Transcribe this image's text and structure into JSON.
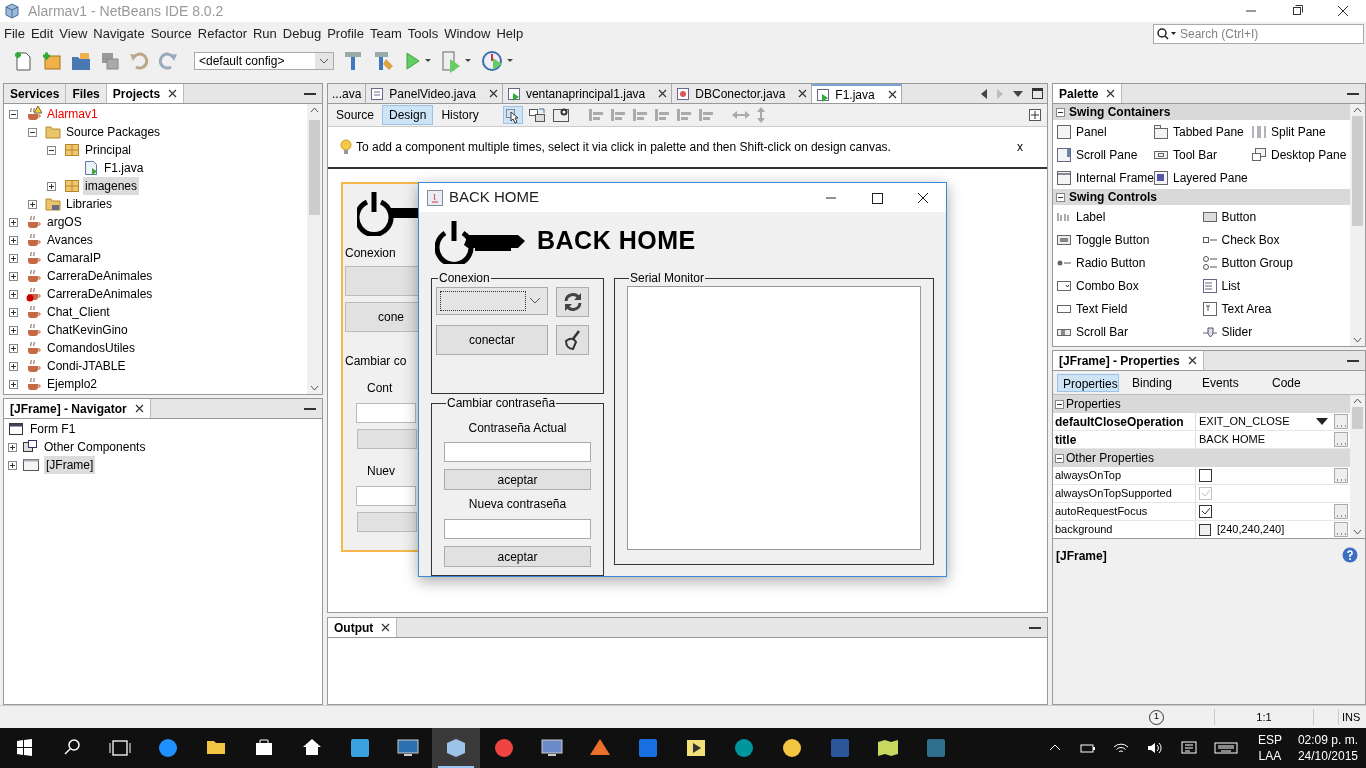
{
  "window": {
    "title": "Alarmav1 - NetBeans IDE 8.0.2"
  },
  "menu": [
    "File",
    "Edit",
    "View",
    "Navigate",
    "Source",
    "Refactor",
    "Run",
    "Debug",
    "Profile",
    "Team",
    "Tools",
    "Window",
    "Help"
  ],
  "search": {
    "placeholder": "Search (Ctrl+I)"
  },
  "toolbar": {
    "config": "<default config>"
  },
  "projects_panel": {
    "tabs": [
      {
        "label": "Services",
        "selected": false,
        "closable": false
      },
      {
        "label": "Files",
        "selected": false,
        "closable": false
      },
      {
        "label": "Projects",
        "selected": true,
        "closable": true
      }
    ],
    "tree": [
      {
        "label": "Alarmav1",
        "kind": "project",
        "warning": true,
        "broken": false,
        "expanded": true,
        "selected": false,
        "children": [
          {
            "label": "Source Packages",
            "kind": "sources",
            "expanded": true,
            "selected": false,
            "children": [
              {
                "label": "Principal",
                "kind": "package",
                "expanded": true,
                "selected": false,
                "children": [
                  {
                    "label": "F1.java",
                    "kind": "file",
                    "selected": false
                  }
                ]
              },
              {
                "label": "imagenes",
                "kind": "package",
                "expanded": false,
                "selected": true
              }
            ]
          },
          {
            "label": "Libraries",
            "kind": "libraries",
            "expanded": false,
            "selected": false
          }
        ]
      },
      {
        "label": "argOS",
        "kind": "project",
        "warning": false,
        "broken": false,
        "expanded": false,
        "selected": false
      },
      {
        "label": "Avances",
        "kind": "project",
        "warning": false,
        "broken": false,
        "expanded": false,
        "selected": false
      },
      {
        "label": "CamaraIP",
        "kind": "project",
        "warning": false,
        "broken": false,
        "expanded": false,
        "selected": false
      },
      {
        "label": "CarreraDeAnimales",
        "kind": "project",
        "warning": false,
        "broken": false,
        "expanded": false,
        "selected": false
      },
      {
        "label": "CarreraDeAnimales",
        "kind": "project",
        "warning": false,
        "broken": true,
        "expanded": false,
        "selected": false
      },
      {
        "label": "Chat_Client",
        "kind": "project",
        "warning": false,
        "broken": false,
        "expanded": false,
        "selected": false
      },
      {
        "label": "ChatKevinGino",
        "kind": "project",
        "warning": false,
        "broken": false,
        "expanded": false,
        "selected": false
      },
      {
        "label": "ComandosUtiles",
        "kind": "project",
        "warning": false,
        "broken": false,
        "expanded": false,
        "selected": false
      },
      {
        "label": "Condi-JTABLE",
        "kind": "project",
        "warning": false,
        "broken": false,
        "expanded": false,
        "selected": false
      },
      {
        "label": "Ejemplo2",
        "kind": "project",
        "warning": false,
        "broken": false,
        "expanded": false,
        "selected": false
      }
    ]
  },
  "navigator": {
    "title": "[JFrame] - Navigator",
    "tree": [
      {
        "label": "Form F1",
        "kind": "form",
        "selected": false
      },
      {
        "label": "Other Components",
        "kind": "components",
        "expanded": false,
        "selected": false
      },
      {
        "label": "[JFrame]",
        "kind": "frame",
        "expanded": false,
        "selected": true
      }
    ]
  },
  "editor": {
    "tabs": [
      {
        "label": "...ava",
        "kind": "none",
        "selected": false,
        "closable": false
      },
      {
        "label": "PanelVideo.java",
        "kind": "class",
        "selected": false,
        "closable": true
      },
      {
        "label": "ventanaprincipal1.java",
        "kind": "form",
        "selected": false,
        "closable": true
      },
      {
        "label": "DBConector.java",
        "kind": "db",
        "selected": false,
        "closable": true
      },
      {
        "label": "F1.java",
        "kind": "form",
        "selected": true,
        "closable": true
      }
    ],
    "views": [
      {
        "label": "Source",
        "selected": false
      },
      {
        "label": "Design",
        "selected": true
      },
      {
        "label": "History",
        "selected": false
      }
    ],
    "hint": {
      "text": "To add a component multiple times, select it via click in palette and then Shift-click on design canvas.",
      "close": "x"
    },
    "back_form": {
      "group1": "Conexion",
      "button": "cone",
      "group2": "Cambiar co",
      "label1": "Cont",
      "label2": "Nuev"
    },
    "form": {
      "title": "BACK HOME",
      "heading": "BACK HOME",
      "conexion": {
        "legend": "Conexion",
        "connect": "conectar"
      },
      "password": {
        "legend": "Cambiar contraseña",
        "current_label": "Contraseña Actual",
        "accept1": "aceptar",
        "new_label": "Nueva contraseña",
        "accept2": "aceptar"
      },
      "monitor": {
        "legend": "Serial Monitor"
      }
    }
  },
  "output": {
    "title": "Output"
  },
  "palette": {
    "title": "Palette",
    "categories": [
      {
        "label": "Swing Containers",
        "expanded": true,
        "items": [
          {
            "label": "Panel",
            "kind": "panel"
          },
          {
            "label": "Tabbed Pane",
            "kind": "tabs"
          },
          {
            "label": "Split Pane",
            "kind": "split"
          },
          {
            "label": "Scroll Pane",
            "kind": "scroll"
          },
          {
            "label": "Tool Bar",
            "kind": "toolbar"
          },
          {
            "label": "Desktop Pane",
            "kind": "desktop"
          },
          {
            "label": "Internal Frame",
            "kind": "frame"
          },
          {
            "label": "Layered Pane",
            "kind": "layered"
          }
        ]
      },
      {
        "label": "Swing Controls",
        "expanded": true,
        "items": [
          {
            "label": "Label",
            "kind": "label"
          },
          {
            "label": "Button",
            "kind": "button"
          },
          {
            "label": "Toggle Button",
            "kind": "toggle"
          },
          {
            "label": "Check Box",
            "kind": "check"
          },
          {
            "label": "Radio Button",
            "kind": "radio"
          },
          {
            "label": "Button Group",
            "kind": "group"
          },
          {
            "label": "Combo Box",
            "kind": "combo"
          },
          {
            "label": "List",
            "kind": "list"
          },
          {
            "label": "Text Field",
            "kind": "field"
          },
          {
            "label": "Text Area",
            "kind": "area"
          },
          {
            "label": "Scroll Bar",
            "kind": "scrollbar"
          },
          {
            "label": "Slider",
            "kind": "slider"
          }
        ]
      }
    ]
  },
  "properties": {
    "title": "[JFrame] - Properties",
    "tabs": [
      {
        "label": "Properties",
        "selected": true
      },
      {
        "label": "Binding",
        "selected": false
      },
      {
        "label": "Events",
        "selected": false
      },
      {
        "label": "Code",
        "selected": false
      }
    ],
    "sections": [
      {
        "label": "Properties",
        "expanded": true,
        "rows": [
          {
            "name": "defaultCloseOperation",
            "kind": "dropdown",
            "modified": true,
            "value": "EXIT_ON_CLOSE",
            "editor": true
          },
          {
            "name": "title",
            "kind": "text",
            "modified": true,
            "value": "BACK HOME",
            "editor": true
          }
        ]
      },
      {
        "label": "Other Properties",
        "expanded": true,
        "rows": [
          {
            "name": "alwaysOnTop",
            "kind": "checkbox",
            "modified": false,
            "checked": false,
            "disabled": false,
            "editor": true
          },
          {
            "name": "alwaysOnTopSupported",
            "kind": "checkbox",
            "modified": false,
            "checked": true,
            "disabled": true,
            "editor": false
          },
          {
            "name": "autoRequestFocus",
            "kind": "checkbox",
            "modified": false,
            "checked": true,
            "disabled": false,
            "editor": true
          },
          {
            "name": "background",
            "kind": "color",
            "modified": false,
            "value": "[240,240,240]",
            "editor": true
          }
        ]
      }
    ],
    "footer": "[JFrame]"
  },
  "status_bar": {
    "notifications": "1",
    "position": "1:1",
    "mode": "INS"
  },
  "taskbar": {
    "apps": [
      {
        "kind": "edge",
        "selected": false
      },
      {
        "kind": "explorer",
        "selected": false
      },
      {
        "kind": "store",
        "selected": false
      },
      {
        "kind": "home",
        "selected": false
      },
      {
        "kind": "mail",
        "selected": false
      },
      {
        "kind": "monitor",
        "selected": false
      },
      {
        "kind": "cube",
        "selected": true
      },
      {
        "kind": "chrome",
        "selected": false
      },
      {
        "kind": "network",
        "selected": false
      },
      {
        "kind": "matlab",
        "selected": false
      },
      {
        "kind": "maxthon",
        "selected": false
      },
      {
        "kind": "labview",
        "selected": false
      },
      {
        "kind": "arduino",
        "selected": false
      },
      {
        "kind": "paw",
        "selected": false
      },
      {
        "kind": "word",
        "selected": false
      },
      {
        "kind": "maps",
        "selected": false
      },
      {
        "kind": "mysql",
        "selected": false
      }
    ],
    "language": "ESP",
    "layout": "LAA",
    "time": "02:09 p. m.",
    "date": "24/10/2015"
  }
}
